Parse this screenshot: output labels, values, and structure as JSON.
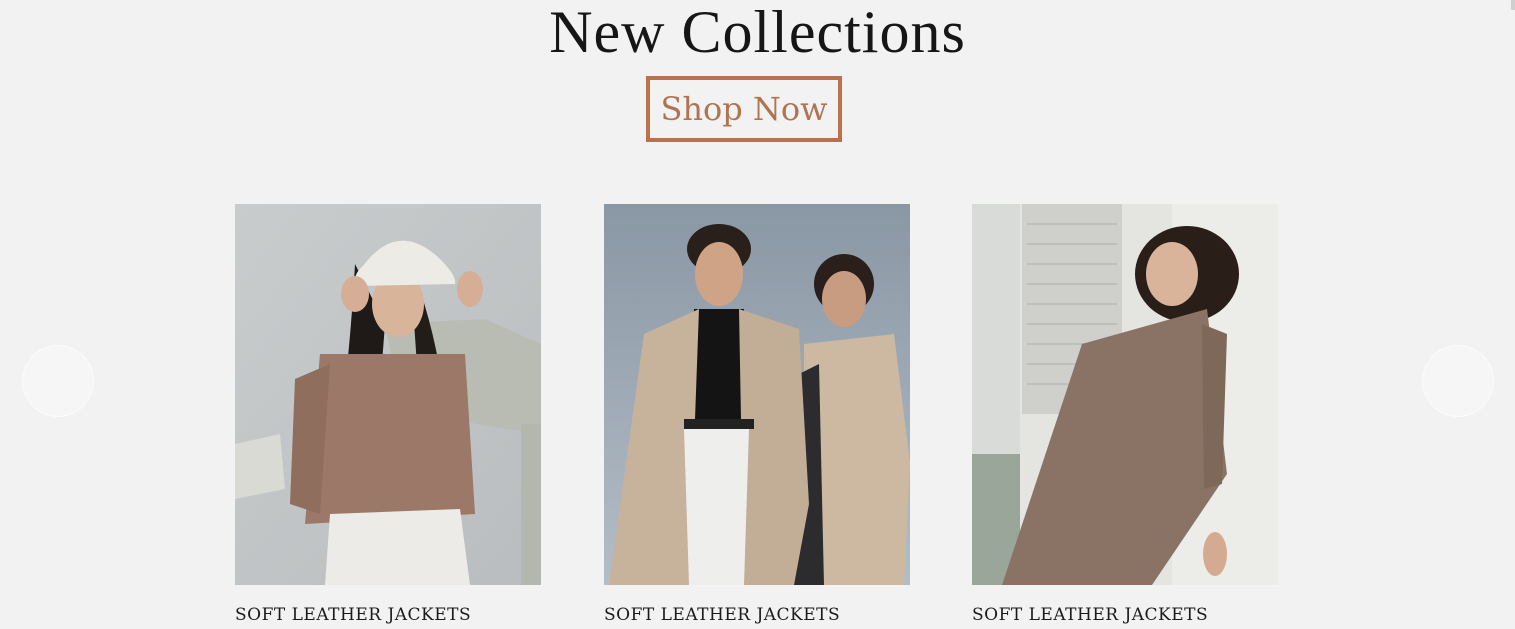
{
  "section": {
    "title": "New Collections",
    "cta_label": "Shop Now"
  },
  "products": [
    {
      "label": "SOFT LEATHER JACKETS",
      "image": "woman-white-bucket-hat-brown-top"
    },
    {
      "label": "SOFT LEATHER JACKETS",
      "image": "two-women-beige-trench-coats"
    },
    {
      "label": "SOFT LEATHER JACKETS",
      "image": "woman-plaid-brown-suit"
    }
  ],
  "carousel": {
    "prev_icon": "chevron-left-icon",
    "next_icon": "chevron-right-icon"
  },
  "colors": {
    "background": "#f2f2f2",
    "accent": "#b9724d",
    "text": "#161616"
  }
}
